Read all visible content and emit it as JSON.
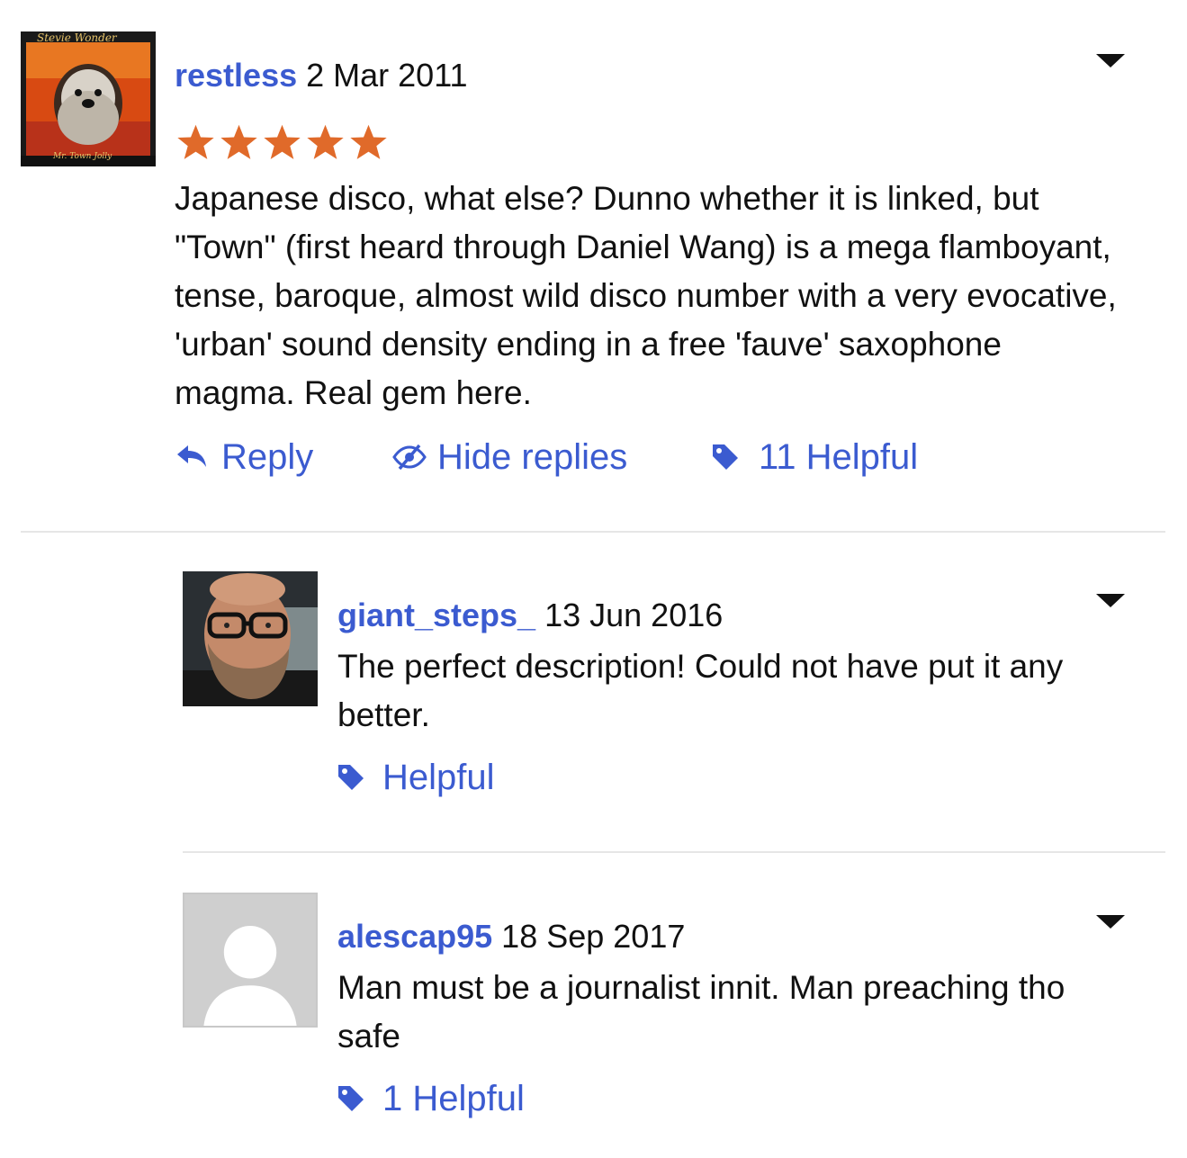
{
  "review": {
    "username": "restless",
    "date": "2 Mar 2011",
    "rating": 5,
    "rating_max": 5,
    "text": "Japanese disco, what else? Dunno whether it is linked, but \"Town\" (first heard through Daniel Wang) is a mega flamboyant, tense, baroque, almost wild disco number with a very evocative, 'urban' sound density ending in a free 'fauve' saxophone magma. Real gem here.",
    "avatar_caption": "Stevie Wonder",
    "avatar_subcaption": "Mr. Town Jolly",
    "actions": {
      "reply": "Reply",
      "hide_replies": "Hide replies",
      "helpful": "11 Helpful"
    }
  },
  "replies": [
    {
      "username": "giant_steps_",
      "date": "13 Jun 2016",
      "text": "The perfect description! Could not have put it any better.",
      "helpful": "Helpful"
    },
    {
      "username": "alescap95",
      "date": "18 Sep 2017",
      "text": "Man must be a journalist innit. Man preaching tho safe",
      "helpful": "1 Helpful"
    }
  ],
  "colors": {
    "link": "#3b5bd0",
    "star": "#e06a2a",
    "divider": "#e6e6e6"
  },
  "icons": {
    "reply": "reply-arrow-icon",
    "hide": "eye-slash-icon",
    "helpful": "tag-icon",
    "menu": "caret-down-icon"
  }
}
